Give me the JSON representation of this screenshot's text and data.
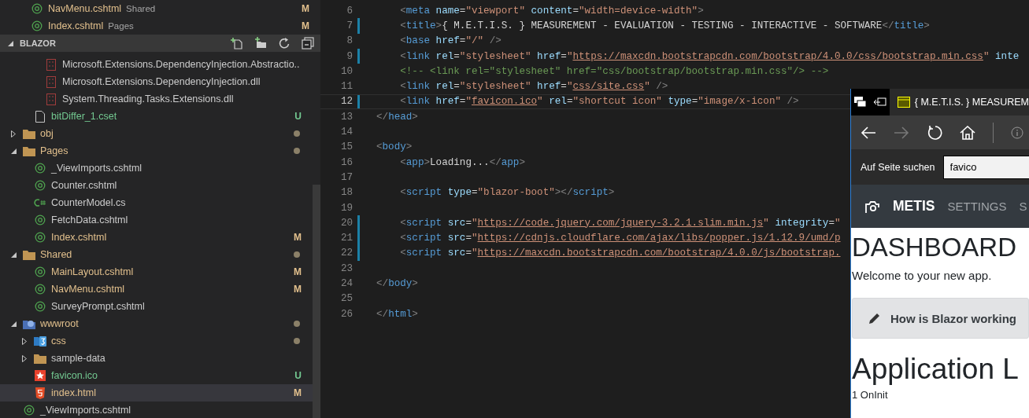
{
  "explorer": {
    "open_editors": [
      {
        "name": "NavMenu.cshtml",
        "description": "Shared",
        "kind": "razor",
        "modified": true,
        "badge": "M"
      },
      {
        "name": "Index.cshtml",
        "description": "Pages",
        "kind": "razor",
        "modified": true,
        "badge": "M"
      }
    ],
    "section_title": "BLAZOR",
    "tree": [
      {
        "children": [
          {
            "children": [
              {
                "name": "Microsoft.Extensions.DependencyInjection.Abstractio..",
                "kind": "dll",
                "selected": false
              },
              {
                "name": "Microsoft.Extensions.DependencyInjection.dll",
                "kind": "dll",
                "selected": false
              },
              {
                "name": "System.Threading.Tasks.Extensions.dll",
                "kind": "dll",
                "selected": false
              }
            ]
          },
          {
            "name": "bitDiffer_1.cset",
            "kind": "file",
            "untracked": true,
            "badge": "U",
            "selected": false
          }
        ]
      },
      {
        "name": "obj",
        "kind": "folder",
        "expanded": false,
        "modified": true,
        "dot": true,
        "selected": false
      },
      {
        "name": "Pages",
        "kind": "folder",
        "expanded": true,
        "modified": true,
        "dot": true,
        "selected": false,
        "children": [
          {
            "name": "_ViewImports.cshtml",
            "kind": "razor",
            "selected": false
          },
          {
            "name": "Counter.cshtml",
            "kind": "razor",
            "selected": false
          },
          {
            "name": "CounterModel.cs",
            "kind": "csharp",
            "selected": false
          },
          {
            "name": "FetchData.cshtml",
            "kind": "razor",
            "selected": false
          },
          {
            "name": "Index.cshtml",
            "kind": "razor",
            "modified": true,
            "badge": "M",
            "selected": false
          }
        ]
      },
      {
        "name": "Shared",
        "kind": "folder",
        "expanded": true,
        "modified": true,
        "dot": true,
        "selected": false,
        "children": [
          {
            "name": "MainLayout.cshtml",
            "kind": "razor",
            "modified": true,
            "badge": "M",
            "selected": false
          },
          {
            "name": "NavMenu.cshtml",
            "kind": "razor",
            "modified": true,
            "badge": "M",
            "selected": false
          },
          {
            "name": "SurveyPrompt.cshtml",
            "kind": "razor",
            "selected": false
          }
        ]
      },
      {
        "name": "wwwroot",
        "kind": "web-folder",
        "expanded": true,
        "modified": true,
        "dot": true,
        "selected": false,
        "children": [
          {
            "name": "css",
            "kind": "css-folder",
            "expanded": false,
            "modified": true,
            "dot": true,
            "selected": false
          },
          {
            "name": "sample-data",
            "kind": "folder",
            "expanded": false,
            "selected": false
          },
          {
            "name": "favicon.ico",
            "kind": "favicon",
            "untracked": true,
            "badge": "U",
            "selected": false
          },
          {
            "name": "index.html",
            "kind": "html",
            "modified": true,
            "badge": "M",
            "selected": true
          }
        ]
      },
      {
        "name": "_ViewImports.cshtml",
        "kind": "razor",
        "selected": false
      }
    ]
  },
  "editor": {
    "lines": [
      {
        "number": "6",
        "changed": false,
        "current": false,
        "tokens": [
          {
            "kind": "bracket",
            "text": "    <"
          },
          {
            "kind": "tag",
            "text": "meta"
          },
          {
            "kind": "attr",
            "text": " name"
          },
          {
            "kind": "text",
            "text": "="
          },
          {
            "kind": "string",
            "text": "\"viewport\""
          },
          {
            "kind": "attr",
            "text": " content"
          },
          {
            "kind": "text",
            "text": "="
          },
          {
            "kind": "string",
            "text": "\"width=device-width\""
          },
          {
            "kind": "bracket",
            "text": ">"
          }
        ]
      },
      {
        "number": "7",
        "changed": true,
        "current": false,
        "tokens": [
          {
            "kind": "bracket",
            "text": "    <"
          },
          {
            "kind": "tag",
            "text": "title"
          },
          {
            "kind": "bracket",
            "text": ">"
          },
          {
            "kind": "text",
            "text": "{ M.E.T.I.S. } MEASUREMENT - EVALUATION - TESTING - INTERACTIVE - SOFTWARE"
          },
          {
            "kind": "bracket",
            "text": "</"
          },
          {
            "kind": "tag",
            "text": "title"
          },
          {
            "kind": "bracket",
            "text": ">"
          }
        ]
      },
      {
        "number": "8",
        "changed": false,
        "current": false,
        "tokens": [
          {
            "kind": "bracket",
            "text": "    <"
          },
          {
            "kind": "tag",
            "text": "base"
          },
          {
            "kind": "attr",
            "text": " href"
          },
          {
            "kind": "text",
            "text": "="
          },
          {
            "kind": "string",
            "text": "\"/\""
          },
          {
            "kind": "bracket",
            "text": " />"
          }
        ]
      },
      {
        "number": "9",
        "changed": true,
        "current": false,
        "tokens": [
          {
            "kind": "bracket",
            "text": "    <"
          },
          {
            "kind": "tag",
            "text": "link"
          },
          {
            "kind": "attr",
            "text": " rel"
          },
          {
            "kind": "text",
            "text": "="
          },
          {
            "kind": "string",
            "text": "\"stylesheet\""
          },
          {
            "kind": "attr",
            "text": " href"
          },
          {
            "kind": "text",
            "text": "="
          },
          {
            "kind": "string",
            "text": "\""
          },
          {
            "kind": "link",
            "text": "https://maxcdn.bootstrapcdn.com/bootstrap/4.0.0/css/bootstrap.min.css"
          },
          {
            "kind": "string",
            "text": "\""
          },
          {
            "kind": "attr",
            "text": " inte"
          }
        ]
      },
      {
        "number": "10",
        "changed": false,
        "current": false,
        "tokens": [
          {
            "kind": "comment",
            "text": "    <!-- <link rel=\"stylesheet\" href=\"css/bootstrap/bootstrap.min.css\"/> -->"
          }
        ]
      },
      {
        "number": "11",
        "changed": false,
        "current": false,
        "tokens": [
          {
            "kind": "bracket",
            "text": "    <"
          },
          {
            "kind": "tag",
            "text": "link"
          },
          {
            "kind": "attr",
            "text": " rel"
          },
          {
            "kind": "text",
            "text": "="
          },
          {
            "kind": "string",
            "text": "\"stylesheet\""
          },
          {
            "kind": "attr",
            "text": " href"
          },
          {
            "kind": "text",
            "text": "="
          },
          {
            "kind": "string",
            "text": "\""
          },
          {
            "kind": "link",
            "text": "css/site.css"
          },
          {
            "kind": "string",
            "text": "\""
          },
          {
            "kind": "bracket",
            "text": " />"
          }
        ]
      },
      {
        "number": "12",
        "changed": true,
        "current": true,
        "tokens": [
          {
            "kind": "bracket",
            "text": "    <"
          },
          {
            "kind": "tag",
            "text": "link"
          },
          {
            "kind": "attr",
            "text": " href"
          },
          {
            "kind": "text",
            "text": "="
          },
          {
            "kind": "string",
            "text": "\""
          },
          {
            "kind": "link",
            "text": "favicon.ico"
          },
          {
            "kind": "string",
            "text": "\""
          },
          {
            "kind": "attr",
            "text": " rel"
          },
          {
            "kind": "text",
            "text": "="
          },
          {
            "kind": "string",
            "text": "\"shortcut icon\""
          },
          {
            "kind": "attr",
            "text": " type"
          },
          {
            "kind": "text",
            "text": "="
          },
          {
            "kind": "string",
            "text": "\"image/x-icon\""
          },
          {
            "kind": "bracket",
            "text": " />"
          }
        ]
      },
      {
        "number": "13",
        "changed": false,
        "current": false,
        "tokens": [
          {
            "kind": "bracket",
            "text": "</"
          },
          {
            "kind": "tag",
            "text": "head"
          },
          {
            "kind": "bracket",
            "text": ">"
          }
        ]
      },
      {
        "number": "14",
        "changed": false,
        "current": false
      },
      {
        "number": "15",
        "changed": false,
        "current": false,
        "tokens": [
          {
            "kind": "bracket",
            "text": "<"
          },
          {
            "kind": "tag",
            "text": "body"
          },
          {
            "kind": "bracket",
            "text": ">"
          }
        ]
      },
      {
        "number": "16",
        "changed": false,
        "current": false,
        "tokens": [
          {
            "kind": "bracket",
            "text": "    <"
          },
          {
            "kind": "tag",
            "text": "app"
          },
          {
            "kind": "bracket",
            "text": ">"
          },
          {
            "kind": "text",
            "text": "Loading..."
          },
          {
            "kind": "bracket",
            "text": "</"
          },
          {
            "kind": "tag",
            "text": "app"
          },
          {
            "kind": "bracket",
            "text": ">"
          }
        ]
      },
      {
        "number": "17",
        "changed": false,
        "current": false
      },
      {
        "number": "18",
        "changed": false,
        "current": false,
        "tokens": [
          {
            "kind": "bracket",
            "text": "    <"
          },
          {
            "kind": "tag",
            "text": "script"
          },
          {
            "kind": "attr",
            "text": " type"
          },
          {
            "kind": "text",
            "text": "="
          },
          {
            "kind": "string",
            "text": "\"blazor-boot\""
          },
          {
            "kind": "bracket",
            "text": "></"
          },
          {
            "kind": "tag",
            "text": "script"
          },
          {
            "kind": "bracket",
            "text": ">"
          }
        ]
      },
      {
        "number": "19",
        "changed": false,
        "current": false
      },
      {
        "number": "20",
        "changed": true,
        "current": false,
        "tokens": [
          {
            "kind": "bracket",
            "text": "    <"
          },
          {
            "kind": "tag",
            "text": "script"
          },
          {
            "kind": "attr",
            "text": " src"
          },
          {
            "kind": "text",
            "text": "="
          },
          {
            "kind": "string",
            "text": "\""
          },
          {
            "kind": "link",
            "text": "https://code.jquery.com/jquery-3.2.1.slim.min.js"
          },
          {
            "kind": "string",
            "text": "\""
          },
          {
            "kind": "attr",
            "text": " integrity"
          },
          {
            "kind": "text",
            "text": "="
          },
          {
            "kind": "string",
            "text": "\""
          }
        ]
      },
      {
        "number": "21",
        "changed": true,
        "current": false,
        "tokens": [
          {
            "kind": "bracket",
            "text": "    <"
          },
          {
            "kind": "tag",
            "text": "script"
          },
          {
            "kind": "attr",
            "text": " src"
          },
          {
            "kind": "text",
            "text": "="
          },
          {
            "kind": "string",
            "text": "\""
          },
          {
            "kind": "link",
            "text": "https://cdnjs.cloudflare.com/ajax/libs/popper.js/1.12.9/umd/p"
          }
        ]
      },
      {
        "number": "22",
        "changed": true,
        "current": false,
        "tokens": [
          {
            "kind": "bracket",
            "text": "    <"
          },
          {
            "kind": "tag",
            "text": "script"
          },
          {
            "kind": "attr",
            "text": " src"
          },
          {
            "kind": "text",
            "text": "="
          },
          {
            "kind": "string",
            "text": "\""
          },
          {
            "kind": "link",
            "text": "https://maxcdn.bootstrapcdn.com/bootstrap/4.0.0/js/bootstrap."
          }
        ]
      },
      {
        "number": "23",
        "changed": false,
        "current": false
      },
      {
        "number": "24",
        "changed": false,
        "current": false,
        "tokens": [
          {
            "kind": "bracket",
            "text": "</"
          },
          {
            "kind": "tag",
            "text": "body"
          },
          {
            "kind": "bracket",
            "text": ">"
          }
        ]
      },
      {
        "number": "25",
        "changed": false,
        "current": false
      },
      {
        "number": "26",
        "changed": false,
        "current": false,
        "tokens": [
          {
            "kind": "bracket",
            "text": "</"
          },
          {
            "kind": "tag",
            "text": "html"
          },
          {
            "kind": "bracket",
            "text": ">"
          }
        ]
      }
    ]
  },
  "browser_window": {
    "tab_title": "{ M.E.T.I.S. } MEASUREM",
    "back_enabled": true,
    "forward_enabled": false,
    "find_label": "Auf Seite suchen",
    "find_value": "favico",
    "site": {
      "brand": "METIS",
      "nav": [
        {
          "label": "SETTINGS"
        },
        {
          "label": "S"
        }
      ],
      "heading": "DASHBOARD",
      "welcome": "Welcome to your new app.",
      "alert": "How is Blazor working",
      "section_heading": "Application L",
      "list_item": "1 OnInit"
    }
  }
}
